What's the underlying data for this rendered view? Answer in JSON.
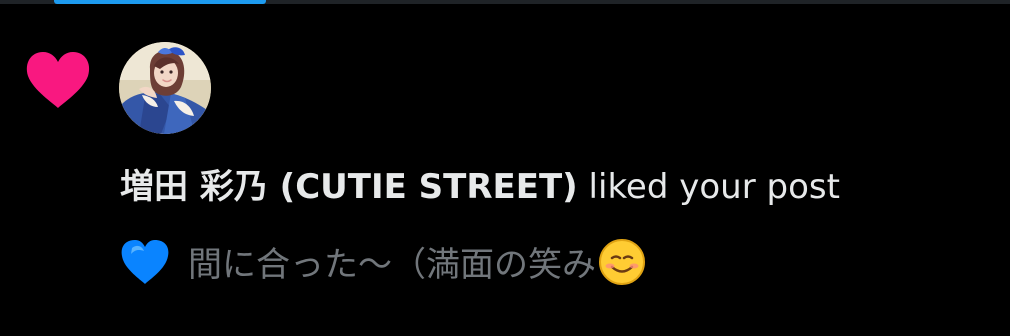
{
  "colors": {
    "background": "#000000",
    "accent": "#1d9bf0",
    "like": "#f91880",
    "primary_text": "#e7e9ea",
    "secondary_text": "#71767b"
  },
  "notification": {
    "icon": "heart-icon",
    "display_name": "増田 彩乃 (CUTIE STREET)",
    "action_text": "liked your post",
    "post_preview": {
      "leading_icon": "blue-heart-icon",
      "text": "間に合った〜（満面の笑み",
      "trailing_icon": "smiling-face-icon"
    }
  }
}
